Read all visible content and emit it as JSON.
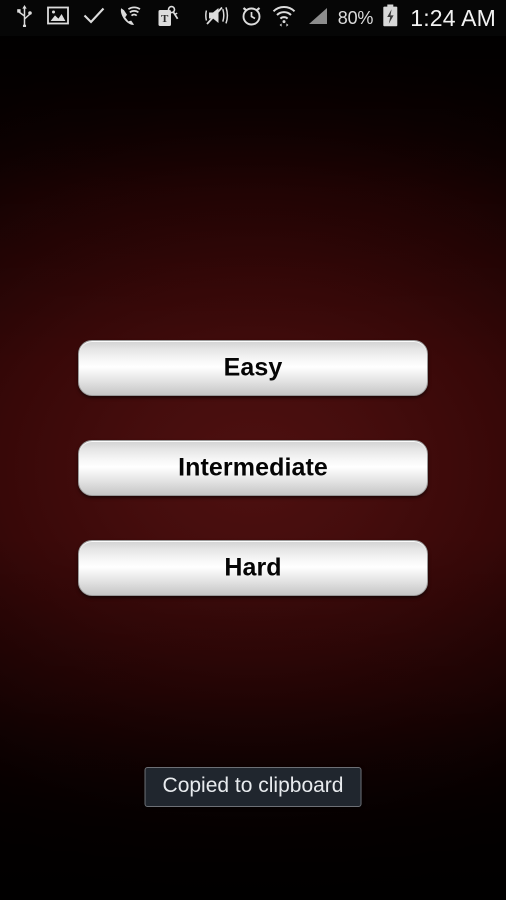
{
  "status_bar": {
    "background_color": "#060606",
    "left_icons": [
      {
        "name": "usb-icon",
        "glyph": "usb"
      },
      {
        "name": "screenshot-image-icon",
        "glyph": "image"
      },
      {
        "name": "checkmark-icon",
        "glyph": "check"
      },
      {
        "name": "wifi-calling-icon",
        "glyph": "wifi-call"
      },
      {
        "name": "tmobile-tag-icon",
        "glyph": "tmobile-keys"
      }
    ],
    "right_icons": [
      {
        "name": "vibrate-mute-icon",
        "glyph": "mute-vibrate"
      },
      {
        "name": "alarm-clock-icon",
        "glyph": "alarm"
      },
      {
        "name": "wifi-icon",
        "glyph": "wifi"
      },
      {
        "name": "cellular-signal-icon",
        "glyph": "signal"
      }
    ],
    "battery_percent": "80%",
    "battery_icon": "battery-charging-icon",
    "clock": "1:24 AM"
  },
  "app": {
    "background_accent": "#4e1010",
    "background_base": "#0a0000"
  },
  "difficulty_buttons": [
    {
      "name": "easy-button",
      "label": "Easy"
    },
    {
      "name": "intermediate-button",
      "label": "Intermediate"
    },
    {
      "name": "hard-button",
      "label": "Hard"
    }
  ],
  "toast": {
    "message": "Copied to clipboard",
    "background_color": "#20262e",
    "border_color": "#6d7076",
    "text_color": "#e8ebee"
  }
}
